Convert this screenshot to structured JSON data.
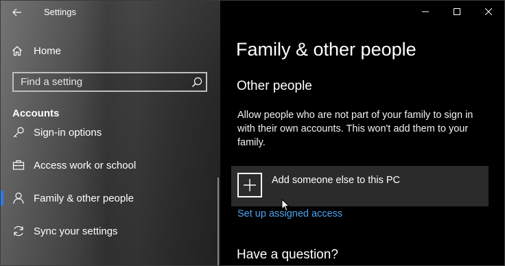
{
  "window": {
    "title": "Settings"
  },
  "sidebar": {
    "home_label": "Home",
    "search_placeholder": "Find a setting",
    "section_heading": "Accounts",
    "items": [
      {
        "label": "Sign-in options",
        "icon": "key-icon"
      },
      {
        "label": "Access work or school",
        "icon": "briefcase-icon"
      },
      {
        "label": "Family & other people",
        "icon": "person-icon",
        "active": true
      },
      {
        "label": "Sync your settings",
        "icon": "sync-icon"
      }
    ]
  },
  "main": {
    "page_title": "Family & other people",
    "section_title": "Other people",
    "description": "Allow people who are not part of your family to sign in with their own accounts. This won't add them to your family.",
    "add_button_label": "Add someone else to this PC",
    "assigned_access_link": "Set up assigned access",
    "question_heading": "Have a question?"
  },
  "colors": {
    "accent": "#2b7de9",
    "link": "#4ea6f2",
    "tile": "#2b2b2b"
  }
}
